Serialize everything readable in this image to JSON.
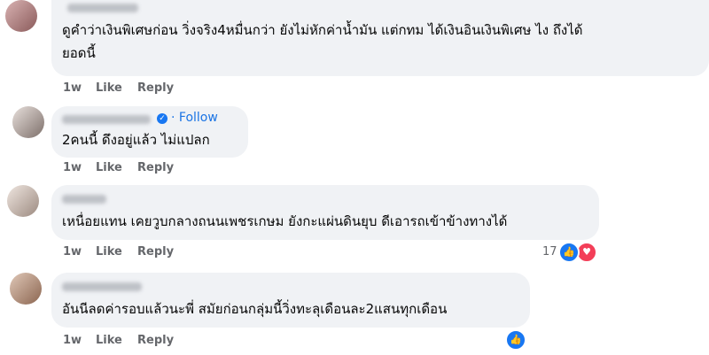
{
  "comments": [
    {
      "name": "",
      "text": "ดูคำว่าเงินพิเศษก่อน วิ่งจริง4หมื่นกว่า ยังไม่หักค่าน้ำมัน แต่กทม ได้เงินอินเงินพิเศษ ไง ถึงได้\nยอดนี้",
      "time": "1w",
      "like": "Like",
      "reply": "Reply"
    },
    {
      "name": "",
      "follow": "Follow",
      "text": "2คนนี้ ดึงอยู่แล้ว ไม่แปลก",
      "time": "1w",
      "like": "Like",
      "reply": "Reply"
    },
    {
      "name": "",
      "text": "เหนื่อยแทน เคยวูบกลางถนนเพชรเกษม ยังกะแผ่นดินยุบ ดีเอารถเข้าข้างทางได้",
      "time": "1w",
      "like": "Like",
      "reply": "Reply",
      "reaction_count": "17"
    },
    {
      "name": "",
      "text": "อันนีลดค่ารอบแล้วนะพี่ สมัยก่อนกลุ่มนี้วิ่งทะลุเดือนละ2แสนทุกเดือน",
      "time": "1w",
      "like": "Like",
      "reply": "Reply"
    }
  ],
  "colors": {
    "bubble": "#f0f2f5",
    "meta": "#65676b",
    "link_blue": "#1b74e4",
    "like_blue": "#1877f2",
    "love_red": "#f33e58"
  }
}
